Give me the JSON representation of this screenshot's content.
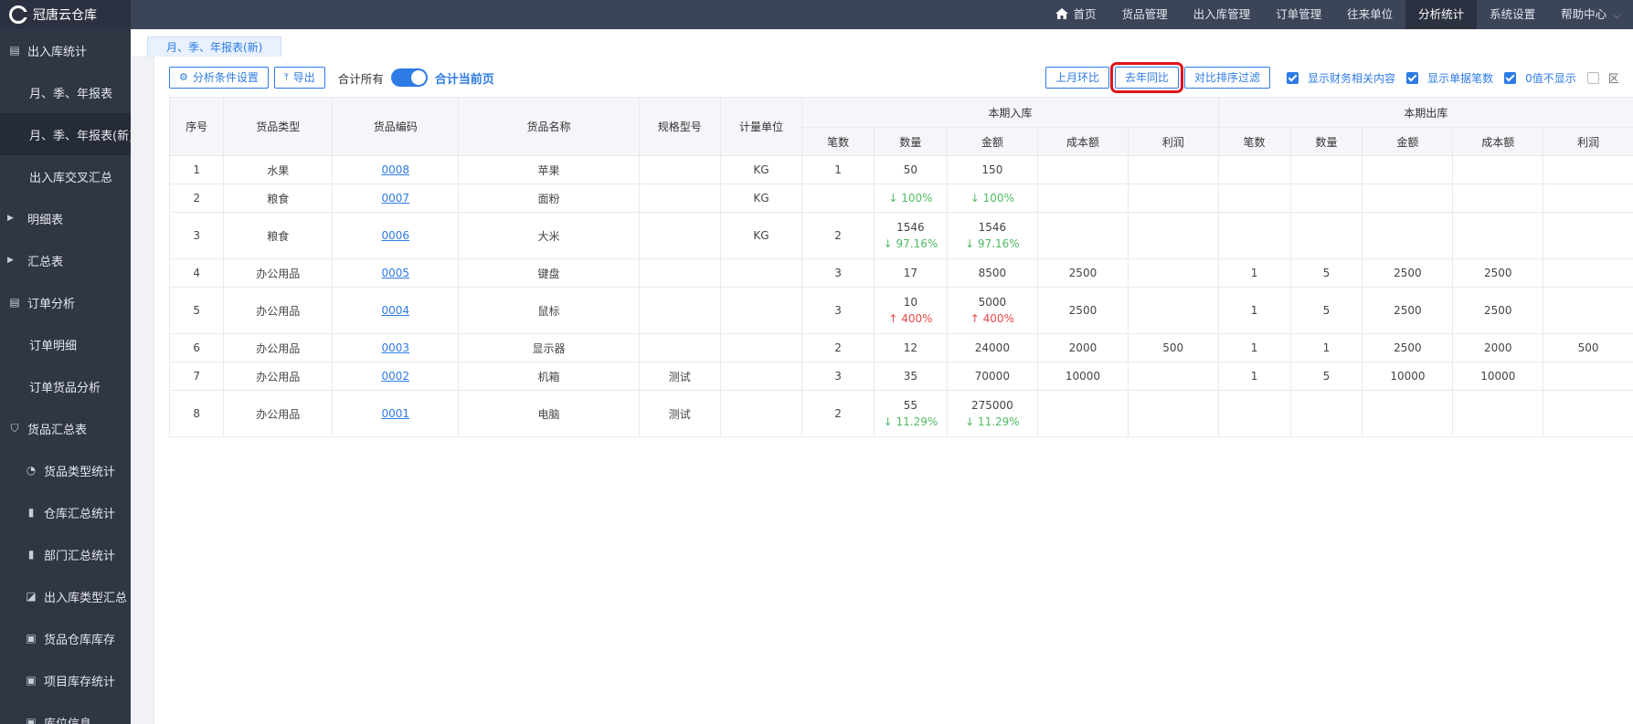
{
  "app": {
    "title": "冠唐云仓库"
  },
  "topnav": [
    {
      "label": "首页",
      "icon": "home-icon"
    },
    {
      "label": "货品管理"
    },
    {
      "label": "出入库管理"
    },
    {
      "label": "订单管理"
    },
    {
      "label": "往来单位"
    },
    {
      "label": "分析统计",
      "active": true
    },
    {
      "label": "系统设置"
    },
    {
      "label": "帮助中心",
      "dropdown": true
    }
  ],
  "sidebar": [
    {
      "label": "出入库统计",
      "kind": "top",
      "icon": "document-icon"
    },
    {
      "label": "月、季、年报表",
      "kind": "sub"
    },
    {
      "label": "月、季、年报表(新)",
      "kind": "sub",
      "active": true
    },
    {
      "label": "出入库交叉汇总",
      "kind": "sub"
    },
    {
      "label": "明细表",
      "kind": "group"
    },
    {
      "label": "汇总表",
      "kind": "group"
    },
    {
      "label": "订单分析",
      "kind": "top",
      "icon": "document-icon"
    },
    {
      "label": "订单明细",
      "kind": "sub"
    },
    {
      "label": "订单货品分析",
      "kind": "sub"
    },
    {
      "label": "货品汇总表",
      "kind": "top",
      "icon": "cart-icon"
    },
    {
      "label": "货品类型统计",
      "kind": "subicon",
      "icon": "pie-chart-icon"
    },
    {
      "label": "仓库汇总统计",
      "kind": "subicon",
      "icon": "bar-chart-icon"
    },
    {
      "label": "部门汇总统计",
      "kind": "subicon",
      "icon": "bar-chart-icon"
    },
    {
      "label": "出入库类型汇总",
      "kind": "subicon",
      "icon": "line-chart-icon"
    },
    {
      "label": "货品仓库库存",
      "kind": "subicon",
      "icon": "package-icon"
    },
    {
      "label": "项目库存统计",
      "kind": "subicon",
      "icon": "package-icon"
    },
    {
      "label": "库位信息",
      "kind": "subicon",
      "icon": "package-icon"
    }
  ],
  "tabs": [
    {
      "label": "月、季、年报表(新)"
    }
  ],
  "toolbar": {
    "analysis_settings": "分析条件设置",
    "export": "导出",
    "sum_all": "合计所有",
    "sum_page": "合计当前页",
    "prev_month": "上月环比",
    "last_year": "去年同比",
    "sort_filter": "对比排序过滤",
    "show_finance": "显示财务相关内容",
    "show_doc_count": "显示单据笔数",
    "hide_zero": "0值不显示",
    "partial": "区"
  },
  "table": {
    "headers": {
      "seq": "序号",
      "type": "货品类型",
      "code": "货品编码",
      "name": "货品名称",
      "spec": "规格型号",
      "unit": "计量单位",
      "in_group": "本期入库",
      "out_group": "本期出库",
      "count": "笔数",
      "qty": "数量",
      "amount": "金额",
      "cost": "成本额",
      "profit": "利润"
    },
    "rows": [
      {
        "seq": "1",
        "type": "水果",
        "code": "0008",
        "name": "苹果",
        "spec": "",
        "unit": "KG",
        "in_count": "1",
        "in_qty": "50",
        "in_qty_pct": "",
        "in_amount": "150",
        "in_amount_pct": "",
        "in_cost": "",
        "in_profit": "",
        "out_count": "",
        "out_qty": "",
        "out_amount": "",
        "out_cost": "",
        "out_profit": ""
      },
      {
        "seq": "2",
        "type": "粮食",
        "code": "0007",
        "name": "面粉",
        "spec": "",
        "unit": "KG",
        "in_count": "",
        "in_qty": "",
        "in_qty_pct": "↓ 100%",
        "in_amount": "",
        "in_amount_pct": "↓ 100%",
        "in_cost": "",
        "in_profit": "",
        "out_count": "",
        "out_qty": "",
        "out_amount": "",
        "out_cost": "",
        "out_profit": ""
      },
      {
        "seq": "3",
        "type": "粮食",
        "code": "0006",
        "name": "大米",
        "spec": "",
        "unit": "KG",
        "in_count": "2",
        "in_qty": "1546",
        "in_qty_pct": "↓ 97.16%",
        "in_amount": "1546",
        "in_amount_pct": "↓ 97.16%",
        "in_cost": "",
        "in_profit": "",
        "out_count": "",
        "out_qty": "",
        "out_amount": "",
        "out_cost": "",
        "out_profit": ""
      },
      {
        "seq": "4",
        "type": "办公用品",
        "code": "0005",
        "name": "键盘",
        "spec": "",
        "unit": "",
        "in_count": "3",
        "in_qty": "17",
        "in_qty_pct": "",
        "in_amount": "8500",
        "in_amount_pct": "",
        "in_cost": "2500",
        "in_profit": "",
        "out_count": "1",
        "out_qty": "5",
        "out_amount": "2500",
        "out_cost": "2500",
        "out_profit": ""
      },
      {
        "seq": "5",
        "type": "办公用品",
        "code": "0004",
        "name": "鼠标",
        "spec": "",
        "unit": "",
        "in_count": "3",
        "in_qty": "10",
        "in_qty_pct": "↑ 400%",
        "in_amount": "5000",
        "in_amount_pct": "↑ 400%",
        "in_cost": "2500",
        "in_profit": "",
        "out_count": "1",
        "out_qty": "5",
        "out_amount": "2500",
        "out_cost": "2500",
        "out_profit": ""
      },
      {
        "seq": "6",
        "type": "办公用品",
        "code": "0003",
        "name": "显示器",
        "spec": "",
        "unit": "",
        "in_count": "2",
        "in_qty": "12",
        "in_qty_pct": "",
        "in_amount": "24000",
        "in_amount_pct": "",
        "in_cost": "2000",
        "in_profit": "500",
        "out_count": "1",
        "out_qty": "1",
        "out_amount": "2500",
        "out_cost": "2000",
        "out_profit": "500"
      },
      {
        "seq": "7",
        "type": "办公用品",
        "code": "0002",
        "name": "机箱",
        "spec": "测试",
        "unit": "",
        "in_count": "3",
        "in_qty": "35",
        "in_qty_pct": "",
        "in_amount": "70000",
        "in_amount_pct": "",
        "in_cost": "10000",
        "in_profit": "",
        "out_count": "1",
        "out_qty": "5",
        "out_amount": "10000",
        "out_cost": "10000",
        "out_profit": ""
      },
      {
        "seq": "8",
        "type": "办公用品",
        "code": "0001",
        "name": "电脑",
        "spec": "测试",
        "unit": "",
        "in_count": "2",
        "in_qty": "55",
        "in_qty_pct": "↓ 11.29%",
        "in_amount": "275000",
        "in_amount_pct": "↓ 11.29%",
        "in_cost": "",
        "in_profit": "",
        "out_count": "",
        "out_qty": "",
        "out_amount": "",
        "out_cost": "",
        "out_profit": ""
      }
    ]
  }
}
